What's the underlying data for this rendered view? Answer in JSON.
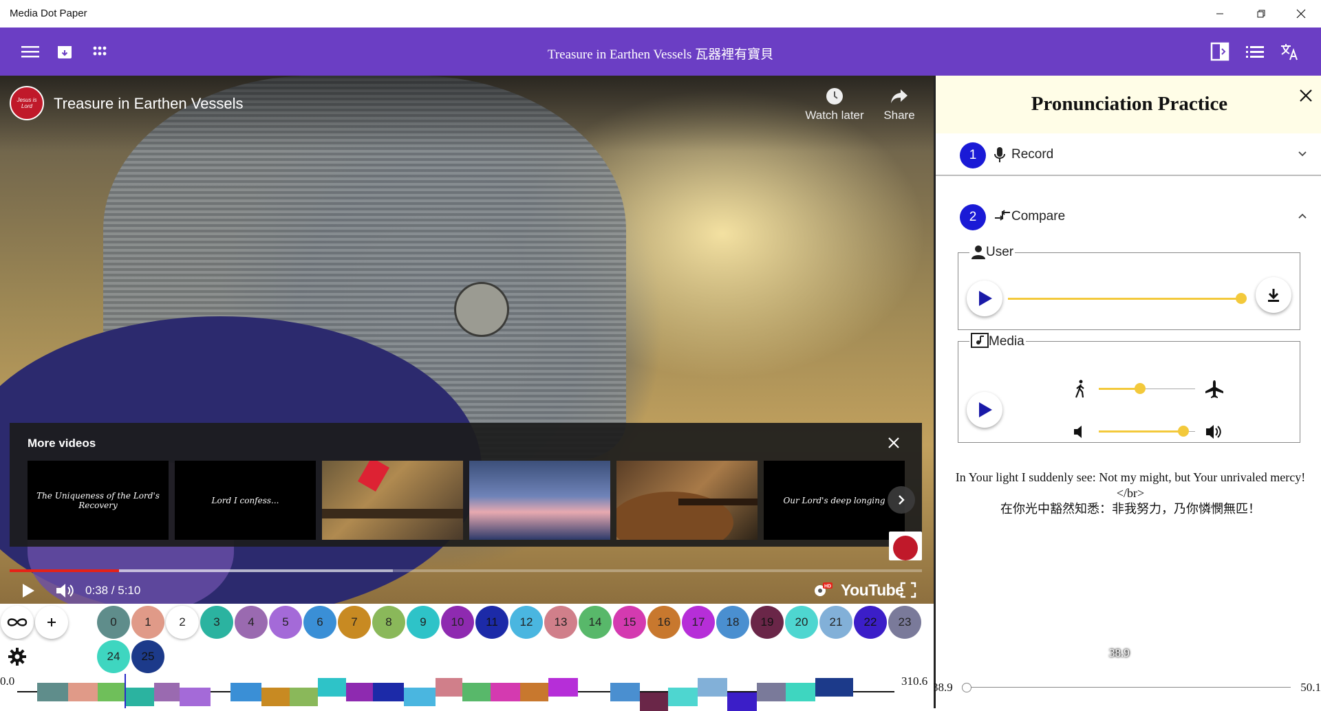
{
  "window": {
    "title": "Media Dot Paper"
  },
  "appbar": {
    "title": "Treasure in Earthen Vessels 瓦器裡有寶貝"
  },
  "player": {
    "channel_logo_text": "Jesus is Lord",
    "video_title": "Treasure in Earthen Vessels",
    "watch_later": "Watch later",
    "share": "Share",
    "more_videos_label": "More videos",
    "thumbnails": [
      {
        "caption": "The Uniqueness of the Lord's Recovery",
        "bg": "#000000"
      },
      {
        "caption": "Lord I confess...",
        "bg": "#000000"
      },
      {
        "caption": "",
        "bg": "#8a6b3a"
      },
      {
        "caption": "",
        "bg": "#6f83b8"
      },
      {
        "caption": "",
        "bg": "#5a3e26"
      },
      {
        "caption": "Our Lord's deep longing",
        "bg": "#000000"
      }
    ],
    "time": "0:38 / 5:10",
    "played_fraction": 0.12,
    "loaded_fraction": 0.42,
    "brand": "YouTube"
  },
  "panel": {
    "title": "Pronunciation Practice",
    "steps": [
      {
        "number": "1",
        "label": "Record"
      },
      {
        "number": "2",
        "label": "Compare"
      }
    ],
    "user_legend": "User",
    "user_playback_fraction": 0.98,
    "media_legend": "Media",
    "speed_fraction": 0.43,
    "volume_fraction": 0.88,
    "lyrics": {
      "line1": "In Your light I suddenly see: Not my might, but Your unrivaled mercy!",
      "line2": "</br>",
      "line3": "在你光中豁然知悉：非我努力，乃你憐憫無匹！"
    },
    "range": {
      "current": "38.9",
      "min": "38.9",
      "max": "50.1",
      "fraction": 0
    }
  },
  "timeline": {
    "min": "0.0",
    "max": "310.6",
    "chips": [
      {
        "label": "0",
        "color": "#5f8d8b"
      },
      {
        "label": "1",
        "color": "#e09a88"
      },
      {
        "label": "2",
        "color": "#ffffff"
      },
      {
        "label": "3",
        "color": "#2bb3a0"
      },
      {
        "label": "4",
        "color": "#9a6ab0"
      },
      {
        "label": "5",
        "color": "#a46ad8"
      },
      {
        "label": "6",
        "color": "#3a8fd6"
      },
      {
        "label": "7",
        "color": "#c88a22"
      },
      {
        "label": "8",
        "color": "#8ab85a"
      },
      {
        "label": "9",
        "color": "#2ec3c8"
      },
      {
        "label": "10",
        "color": "#8e2ab0"
      },
      {
        "label": "11",
        "color": "#1c2aa8"
      },
      {
        "label": "12",
        "color": "#4ab6e0"
      },
      {
        "label": "13",
        "color": "#d07f8a"
      },
      {
        "label": "14",
        "color": "#58b86a"
      },
      {
        "label": "15",
        "color": "#d43ab0"
      },
      {
        "label": "16",
        "color": "#c8782e"
      },
      {
        "label": "17",
        "color": "#b62ed8"
      },
      {
        "label": "18",
        "color": "#4a8fd0"
      },
      {
        "label": "19",
        "color": "#6a2648"
      },
      {
        "label": "20",
        "color": "#4ed6d0"
      },
      {
        "label": "21",
        "color": "#82b0d8"
      },
      {
        "label": "22",
        "color": "#3b1ec8"
      },
      {
        "label": "23",
        "color": "#7a7a9a"
      },
      {
        "label": "24",
        "color": "#3ed6c0"
      },
      {
        "label": "25",
        "color": "#1c3a8a"
      }
    ],
    "segments": [
      {
        "start": 7.0,
        "end": 18.0,
        "color": "#5f8d8b",
        "raise": 0
      },
      {
        "start": 18.0,
        "end": 28.5,
        "color": "#e09a88",
        "raise": 0
      },
      {
        "start": 28.5,
        "end": 38.0,
        "color": "#6fbf5a",
        "raise": 0
      },
      {
        "start": 38.0,
        "end": 48.5,
        "color": "#2bb3a0",
        "raise": -1
      },
      {
        "start": 48.5,
        "end": 57.5,
        "color": "#9a6ab0",
        "raise": 0
      },
      {
        "start": 57.5,
        "end": 68.5,
        "color": "#a46ad8",
        "raise": -1
      },
      {
        "start": 75.5,
        "end": 86.5,
        "color": "#3a8fd6",
        "raise": 0
      },
      {
        "start": 86.5,
        "end": 96.5,
        "color": "#c88a22",
        "raise": -1
      },
      {
        "start": 96.5,
        "end": 106.5,
        "color": "#8ab85a",
        "raise": -1
      },
      {
        "start": 106.5,
        "end": 116.5,
        "color": "#2ec3c8",
        "raise": 1
      },
      {
        "start": 116.5,
        "end": 126.0,
        "color": "#8e2ab0",
        "raise": 0
      },
      {
        "start": 126.0,
        "end": 137.0,
        "color": "#1c2aa8",
        "raise": 0
      },
      {
        "start": 137.0,
        "end": 148.0,
        "color": "#4ab6e0",
        "raise": -1
      },
      {
        "start": 148.0,
        "end": 157.5,
        "color": "#d07f8a",
        "raise": 1
      },
      {
        "start": 157.5,
        "end": 167.5,
        "color": "#58b86a",
        "raise": 0
      },
      {
        "start": 167.5,
        "end": 178.0,
        "color": "#d43ab0",
        "raise": 0
      },
      {
        "start": 178.0,
        "end": 188.0,
        "color": "#c8782e",
        "raise": 0
      },
      {
        "start": 188.0,
        "end": 198.5,
        "color": "#b62ed8",
        "raise": 1
      },
      {
        "start": 210.0,
        "end": 220.5,
        "color": "#4a8fd0",
        "raise": 0
      },
      {
        "start": 220.5,
        "end": 230.5,
        "color": "#6a2648",
        "raise": -2
      },
      {
        "start": 230.5,
        "end": 241.0,
        "color": "#4ed6d0",
        "raise": -1
      },
      {
        "start": 241.0,
        "end": 251.5,
        "color": "#82b0d8",
        "raise": 1
      },
      {
        "start": 251.5,
        "end": 262.0,
        "color": "#3b1ec8",
        "raise": -2
      },
      {
        "start": 262.0,
        "end": 272.0,
        "color": "#7a7a9a",
        "raise": 0
      },
      {
        "start": 272.0,
        "end": 282.5,
        "color": "#3ed6c0",
        "raise": 0
      },
      {
        "start": 282.5,
        "end": 296.0,
        "color": "#1c3a8a",
        "raise": 1
      }
    ],
    "cursor": 38.0
  }
}
